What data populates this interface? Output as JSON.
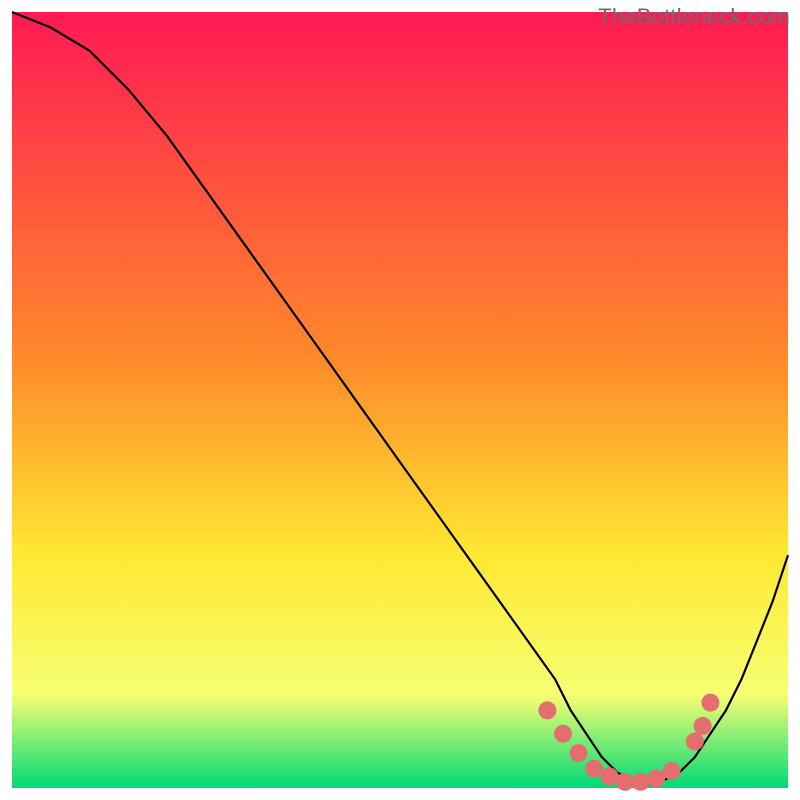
{
  "watermark": "TheBottleneck.com",
  "colors": {
    "curve": "#000000",
    "dot": "#e46e6e",
    "dot_stroke": "#c94f4f",
    "gradient_top": "#ff1a54",
    "gradient_mid1": "#ff8a2a",
    "gradient_mid2": "#ffe932",
    "gradient_mid3": "#f7ff73",
    "gradient_bottom": "#00d976"
  },
  "chart_data": {
    "type": "line",
    "title": "",
    "xlabel": "",
    "ylabel": "",
    "x": [
      0,
      5,
      10,
      15,
      20,
      25,
      30,
      35,
      40,
      45,
      50,
      55,
      60,
      65,
      70,
      72,
      74,
      76,
      78,
      80,
      82,
      84,
      86,
      88,
      90,
      92,
      94,
      96,
      98,
      100
    ],
    "values": [
      100,
      98,
      95,
      90,
      84,
      77,
      70,
      63,
      56,
      49,
      42,
      35,
      28,
      21,
      14,
      10,
      7,
      4,
      2,
      1,
      0.5,
      1,
      2,
      4,
      7,
      10,
      14,
      19,
      24,
      30
    ],
    "xlim": [
      0,
      100
    ],
    "ylim": [
      0,
      100
    ],
    "dots_x": [
      69,
      71,
      73,
      75,
      77,
      79,
      81,
      83,
      85,
      88,
      89,
      90
    ],
    "dots_y": [
      10,
      7,
      4.5,
      2.5,
      1.5,
      0.8,
      0.8,
      1.2,
      2.2,
      6,
      8,
      11
    ]
  }
}
